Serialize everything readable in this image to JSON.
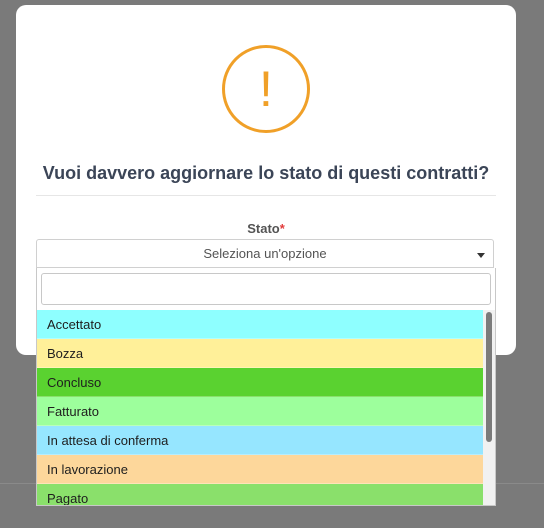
{
  "modal": {
    "icon": "exclamation-icon",
    "icon_glyph": "!",
    "title": "Vuoi davvero aggiornare lo stato di questi contratti?",
    "field": {
      "label": "Stato",
      "required_mark": "*",
      "placeholder": "Seleziona un'opzione"
    }
  },
  "dropdown": {
    "search_value": "",
    "options": [
      {
        "label": "Accettato",
        "color": "#8effff"
      },
      {
        "label": "Bozza",
        "color": "#fff099"
      },
      {
        "label": "Concluso",
        "color": "#5ad230"
      },
      {
        "label": "Fatturato",
        "color": "#9dff9c"
      },
      {
        "label": "In attesa di conferma",
        "color": "#96e6ff"
      },
      {
        "label": "In lavorazione",
        "color": "#fdd79b"
      },
      {
        "label": "Pagato",
        "color": "#8ae06b"
      }
    ]
  },
  "colors": {
    "accent_warning": "#f0a028",
    "title_text": "#3b4557",
    "required": "#e23b3b"
  }
}
